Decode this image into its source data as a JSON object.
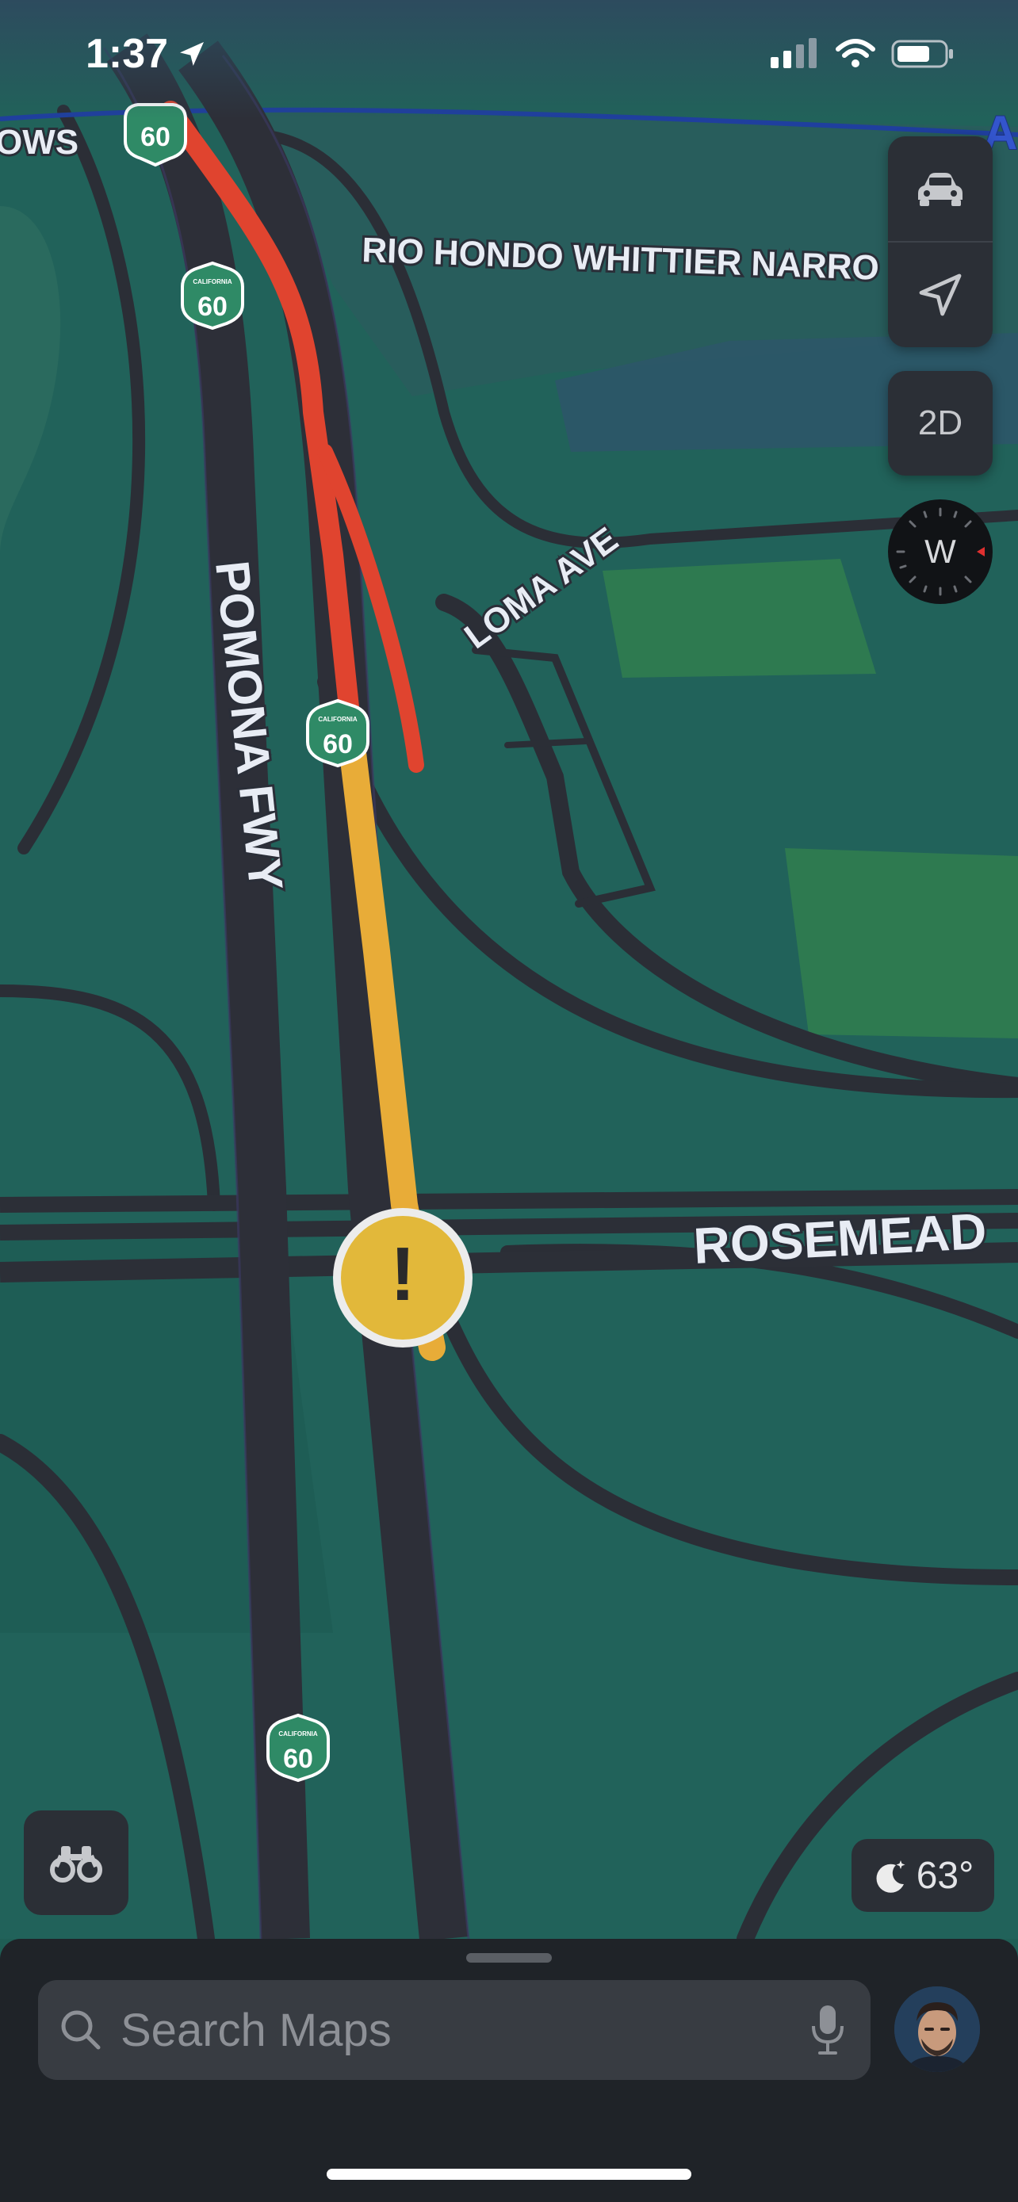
{
  "status_bar": {
    "time": "1:37"
  },
  "map": {
    "roads": {
      "freeway": "POMONA FWY",
      "loma": "LOMA AVE",
      "rosemead": "ROSEMEAD",
      "rio_hondo": "RIO HONDO WHITTIER NARRO",
      "top_left": "OWS",
      "top_right": "A"
    },
    "shields": [
      {
        "route": "60",
        "sub": "CALIFORNIA"
      },
      {
        "route": "60",
        "sub": "CALIFORNIA"
      },
      {
        "route": "60",
        "sub": "CALIFORNIA"
      },
      {
        "route": "60",
        "sub": "CALIFORNIA"
      }
    ],
    "incident_symbol": "!",
    "traffic_colors": {
      "heavy": "#e0442f",
      "moderate": "#e8ac38"
    }
  },
  "controls": {
    "driving_mode_icon": "car-icon",
    "location_icon": "location-arrow-icon",
    "view_toggle": "2D",
    "compass_heading": "W",
    "look_around_icon": "binoculars-icon"
  },
  "weather": {
    "temperature": "63°",
    "icon": "moon-stars-icon"
  },
  "search": {
    "placeholder": "Search Maps"
  }
}
